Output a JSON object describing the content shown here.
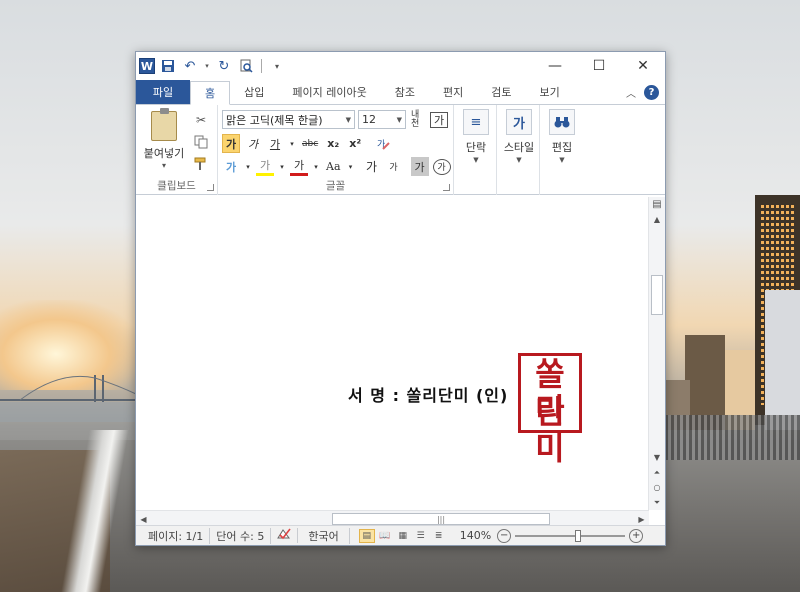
{
  "window": {
    "app_icon": "W",
    "controls": {
      "minimize": "—",
      "maximize": "☐",
      "close": "✕"
    }
  },
  "tabs": {
    "file": "파일",
    "items": [
      "홈",
      "삽입",
      "페이지 레이아웃",
      "참조",
      "편지",
      "검토",
      "보기"
    ],
    "active": "홈"
  },
  "ribbon": {
    "clipboard": {
      "paste_label": "붙여넣기",
      "group_label": "클립보드"
    },
    "font": {
      "family": "맑은 고딕(제목 한글)",
      "size": "12",
      "group_label": "글꼴",
      "buttons": {
        "bold": "가",
        "italic": "가",
        "underline": "가",
        "strike": "abc",
        "subscript": "x₂",
        "superscript": "x²",
        "highlight": "가",
        "color": "가",
        "case": "Aa",
        "grow": "가",
        "shrink": "가",
        "char_shade": "가",
        "enclose": "가",
        "phonetic": "내천",
        "border": "가"
      }
    },
    "paragraph": {
      "label": "단락"
    },
    "styles": {
      "label": "스타일"
    },
    "editing": {
      "label": "편집"
    }
  },
  "document": {
    "signature_text": "서 명 : 쏠리단미 (인)",
    "seal_line1": "쏠리",
    "seal_line2": "단미"
  },
  "statusbar": {
    "page": "페이지: 1/1",
    "words": "단어 수: 5",
    "language": "한국어",
    "zoom": "140%",
    "zoom_minus": "−",
    "zoom_plus": "+"
  }
}
